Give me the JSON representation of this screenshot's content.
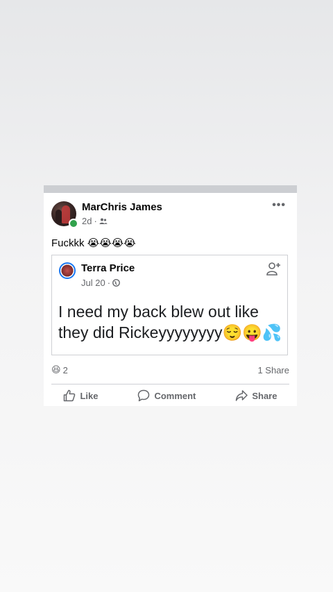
{
  "post": {
    "author": "MarChris James",
    "time": "2d",
    "text": "Fuckkk",
    "text_emojis": "😭😭😭😭"
  },
  "shared_post": {
    "author": "Terra Price",
    "date": "Jul 20",
    "body": "I need my back blew out like they did Rickeyyyyyyyy",
    "body_emojis": "😌😛💦"
  },
  "reactions": {
    "emoji": "😆",
    "count": "2",
    "shares": "1 Share"
  },
  "actions": {
    "like": "Like",
    "comment": "Comment",
    "share": "Share"
  }
}
